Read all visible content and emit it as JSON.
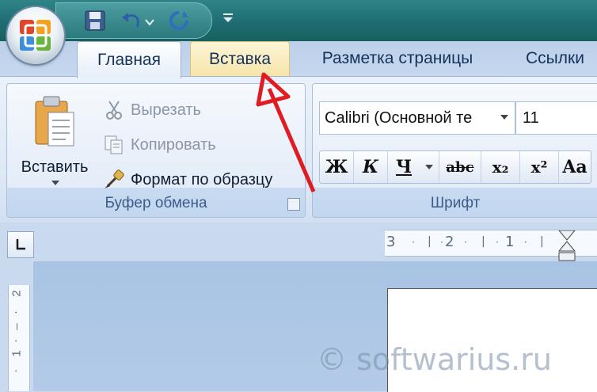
{
  "window": {
    "quick_access": [
      "save-icon",
      "undo-icon",
      "redo-icon",
      "customize-qat-icon"
    ]
  },
  "tabs": [
    {
      "label": "Главная",
      "state": "active"
    },
    {
      "label": "Вставка",
      "state": "hover"
    },
    {
      "label": "Разметка страницы",
      "state": "normal"
    },
    {
      "label": "Ссылки",
      "state": "normal"
    }
  ],
  "clipboard_group": {
    "paste_label": "Вставить",
    "cut_label": "Вырезать",
    "copy_label": "Копировать",
    "format_painter_label": "Формат по образцу",
    "group_label": "Буфер обмена"
  },
  "font_group": {
    "font_name": "Calibri (Основной те",
    "font_size": "11",
    "bold": "Ж",
    "italic": "К",
    "underline": "Ч",
    "strike": "abc",
    "subscript": "x₂",
    "superscript": "x²",
    "change_case": "Aa",
    "group_label": "Шрифт"
  },
  "ruler": {
    "h_ticks": [
      "3",
      "2",
      "1"
    ],
    "v_ticks": [
      "2",
      "1"
    ]
  },
  "annotation": {
    "arrow_color": "#e01b22"
  },
  "watermark": "© softwarius.ru",
  "colors": {
    "title_bar": "#1e6d72",
    "ribbon_bg": "#dde8f6",
    "tab_hover": "#f6e4a8"
  }
}
